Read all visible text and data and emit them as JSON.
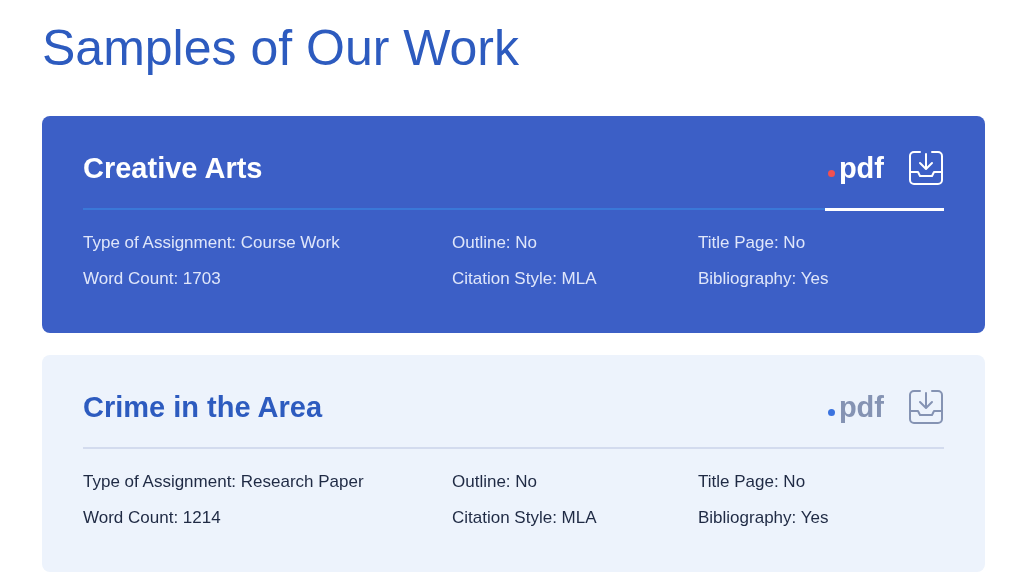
{
  "heading": "Samples of Our Work",
  "samples": [
    {
      "title": "Creative Arts",
      "format": "pdf",
      "selected": true,
      "details": [
        "Type of Assignment: Course Work",
        "Outline: No",
        "Title Page: No",
        "Word Count: 1703",
        "Citation Style: MLA",
        "Bibliography: Yes"
      ]
    },
    {
      "title": "Crime in the Area",
      "format": "pdf",
      "selected": false,
      "details": [
        "Type of Assignment: Research Paper",
        "Outline: No",
        "Title Page: No",
        "Word Count: 1214",
        "Citation Style: MLA",
        "Bibliography: Yes"
      ]
    }
  ]
}
